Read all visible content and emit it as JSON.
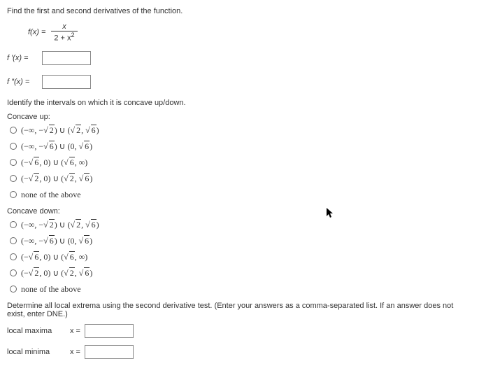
{
  "q1": {
    "instruction": "Find the first and second derivatives of the function.",
    "func_label": "f(x) =",
    "numerator": "x",
    "denominator_prefix": "2 + x",
    "denominator_exp": "2",
    "d1_label": "f ′(x) =",
    "d2_label": "f ″(x) ="
  },
  "q2": {
    "instruction": "Identify the intervals on which it is concave up/down.",
    "up_label": "Concave up:",
    "down_label": "Concave down:",
    "options": {
      "a_prefix": "(−∞, −",
      "a_r1": "2",
      "a_mid": ") ∪ (",
      "a_r2": "2",
      "a_comma": ", ",
      "a_r3": "6",
      "a_end": ")",
      "b_prefix": "(−∞, −",
      "b_r1": "6",
      "b_mid": ") ∪ (0, ",
      "b_r2": "6",
      "b_end": ")",
      "c_prefix": "(−",
      "c_r1": "6",
      "c_mid": ", 0) ∪ (",
      "c_r2": "6",
      "c_end": ", ∞)",
      "d_prefix": "(−",
      "d_r1": "2",
      "d_mid": ", 0) ∪ (",
      "d_r2": "2",
      "d_comma": ", ",
      "d_r3": "6",
      "d_end": ")",
      "none": "none of the above"
    }
  },
  "q3": {
    "instruction": "Determine all local extrema using the second derivative test. (Enter your answers as a comma-separated list. If an answer does not exist, enter DNE.)",
    "max_label": "local maxima",
    "min_label": "local minima",
    "xeq": "x ="
  }
}
